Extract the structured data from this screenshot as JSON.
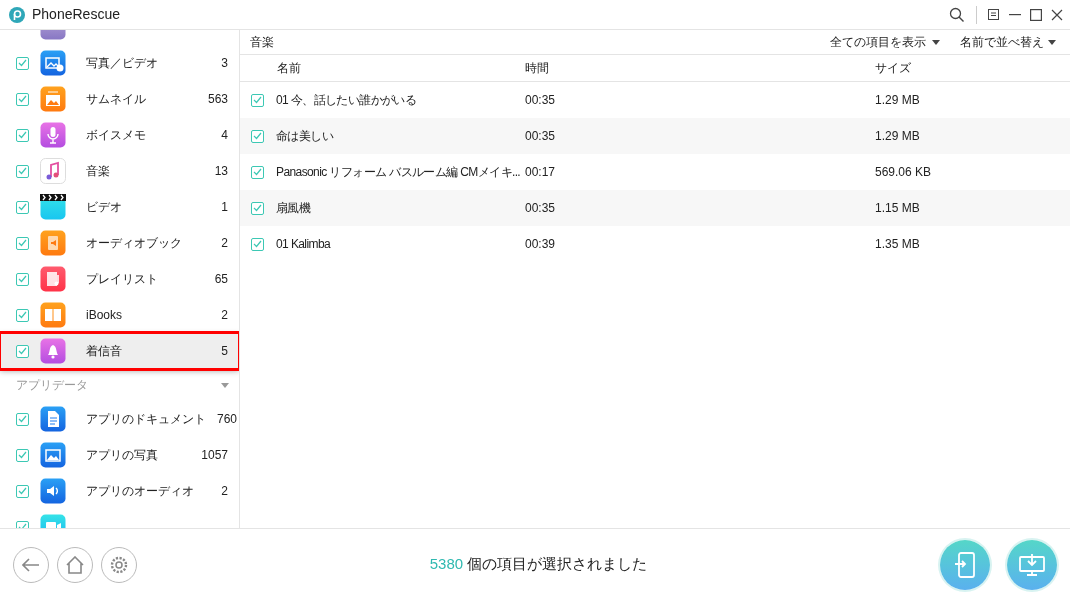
{
  "window": {
    "title": "PhoneRescue"
  },
  "sidebar": {
    "top_partial": {
      "kind": "photos"
    },
    "items": [
      {
        "kind": "photos-video",
        "label": "写真／ビデオ",
        "count": "3",
        "checked": true,
        "selected": false
      },
      {
        "kind": "thumbnail",
        "label": "サムネイル",
        "count": "563",
        "checked": true,
        "selected": false
      },
      {
        "kind": "voice",
        "label": "ボイスメモ",
        "count": "4",
        "checked": true,
        "selected": false
      },
      {
        "kind": "music",
        "label": "音楽",
        "count": "13",
        "checked": true,
        "selected": false
      },
      {
        "kind": "video",
        "label": "ビデオ",
        "count": "1",
        "checked": true,
        "selected": false
      },
      {
        "kind": "audiobook",
        "label": "オーディオブック",
        "count": "2",
        "checked": true,
        "selected": false
      },
      {
        "kind": "playlist",
        "label": "プレイリスト",
        "count": "65",
        "checked": true,
        "selected": false
      },
      {
        "kind": "ibooks",
        "label": "iBooks",
        "count": "2",
        "checked": true,
        "selected": false
      },
      {
        "kind": "ringtone",
        "label": "着信音",
        "count": "5",
        "checked": true,
        "selected": true
      }
    ],
    "section": {
      "label": "アプリデータ",
      "expanded": true
    },
    "section_items": [
      {
        "kind": "app-doc",
        "label": "アプリのドキュメント",
        "count": "760",
        "checked": true,
        "selected": false
      },
      {
        "kind": "app-photo",
        "label": "アプリの写真",
        "count": "1057",
        "checked": true,
        "selected": false
      },
      {
        "kind": "app-audio",
        "label": "アプリのオーディオ",
        "count": "2",
        "checked": true,
        "selected": false
      }
    ],
    "bottom_partial": {
      "kind": "app-video",
      "checked": true
    }
  },
  "content": {
    "title": "音楽",
    "filter": "全ての項目を表示",
    "sort": "名前で並べ替え",
    "columns": [
      "名前",
      "時間",
      "サイズ"
    ],
    "rows": [
      {
        "name": "01 今、話したい誰かがいる",
        "time": "00:35",
        "size": "1.29 MB",
        "checked": true
      },
      {
        "name": "命は美しい",
        "time": "00:35",
        "size": "1.29 MB",
        "checked": true
      },
      {
        "name": "Panasonic リフォーム バスルーム編 CMメイキ...",
        "time": "00:17",
        "size": "569.06 KB",
        "checked": true
      },
      {
        "name": "扇風機",
        "time": "00:35",
        "size": "1.15 MB",
        "checked": true
      },
      {
        "name": "01 Kalimba",
        "time": "00:39",
        "size": "1.35 MB",
        "checked": true
      }
    ]
  },
  "status_bar": {
    "count": "5380",
    "text": "個の項目が選択されました"
  }
}
